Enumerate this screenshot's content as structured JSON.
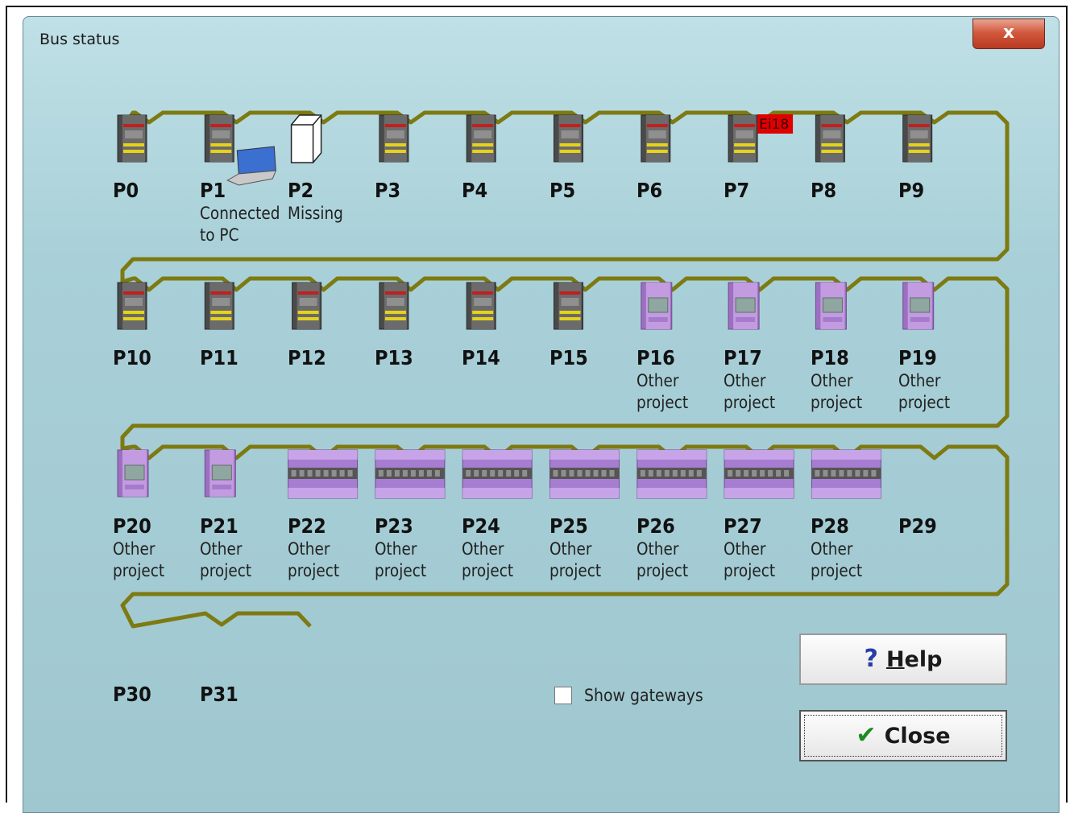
{
  "window": {
    "title": "Bus status",
    "close_glyph": "x"
  },
  "nodes": [
    {
      "label": "P0",
      "sub": "",
      "icon": "safety-module-gray"
    },
    {
      "label": "P1",
      "sub": "Connected to PC",
      "icon": "safety-module-gray-laptop"
    },
    {
      "label": "P2",
      "sub": "Missing",
      "icon": "missing-module-outline"
    },
    {
      "label": "P3",
      "sub": "",
      "icon": "safety-module-gray"
    },
    {
      "label": "P4",
      "sub": "",
      "icon": "safety-module-gray"
    },
    {
      "label": "P5",
      "sub": "",
      "icon": "safety-module-gray"
    },
    {
      "label": "P6",
      "sub": "",
      "icon": "safety-module-gray"
    },
    {
      "label": "P7",
      "sub": "",
      "icon": "safety-module-gray-error",
      "error_badge": "Ei18"
    },
    {
      "label": "P8",
      "sub": "",
      "icon": "safety-module-gray"
    },
    {
      "label": "P9",
      "sub": "",
      "icon": "safety-module-gray"
    },
    {
      "label": "P10",
      "sub": "",
      "icon": "safety-module-gray"
    },
    {
      "label": "P11",
      "sub": "",
      "icon": "safety-module-gray"
    },
    {
      "label": "P12",
      "sub": "",
      "icon": "safety-module-gray"
    },
    {
      "label": "P13",
      "sub": "",
      "icon": "safety-module-gray"
    },
    {
      "label": "P14",
      "sub": "",
      "icon": "safety-module-gray"
    },
    {
      "label": "P15",
      "sub": "",
      "icon": "safety-module-gray"
    },
    {
      "label": "P16",
      "sub": "Other project",
      "icon": "module-purple-small"
    },
    {
      "label": "P17",
      "sub": "Other project",
      "icon": "module-purple-small"
    },
    {
      "label": "P18",
      "sub": "Other project",
      "icon": "module-purple-small"
    },
    {
      "label": "P19",
      "sub": "Other project",
      "icon": "module-purple-small"
    },
    {
      "label": "P20",
      "sub": "Other project",
      "icon": "module-purple-small"
    },
    {
      "label": "P21",
      "sub": "Other project",
      "icon": "module-purple-small"
    },
    {
      "label": "P22",
      "sub": "Other project",
      "icon": "module-purple-wide"
    },
    {
      "label": "P23",
      "sub": "Other project",
      "icon": "module-purple-wide"
    },
    {
      "label": "P24",
      "sub": "Other project",
      "icon": "module-purple-wide"
    },
    {
      "label": "P25",
      "sub": "Other project",
      "icon": "module-purple-wide"
    },
    {
      "label": "P26",
      "sub": "Other project",
      "icon": "module-purple-wide"
    },
    {
      "label": "P27",
      "sub": "Other project",
      "icon": "module-purple-wide"
    },
    {
      "label": "P28",
      "sub": "Other project",
      "icon": "module-purple-wide"
    },
    {
      "label": "P29",
      "sub": "",
      "icon": "none"
    },
    {
      "label": "P30",
      "sub": "",
      "icon": "none"
    },
    {
      "label": "P31",
      "sub": "",
      "icon": "none"
    }
  ],
  "checkbox": {
    "label": "Show gateways",
    "checked": false
  },
  "buttons": {
    "help": {
      "label": "Help",
      "icon": "question-icon"
    },
    "close": {
      "label": "Close",
      "icon": "checkmark-icon"
    }
  },
  "colors": {
    "bus_line": "#7d7a12",
    "error_badge": "#e00000",
    "module_purple": "#b48ad6",
    "module_gray": "#5b5b5b"
  }
}
